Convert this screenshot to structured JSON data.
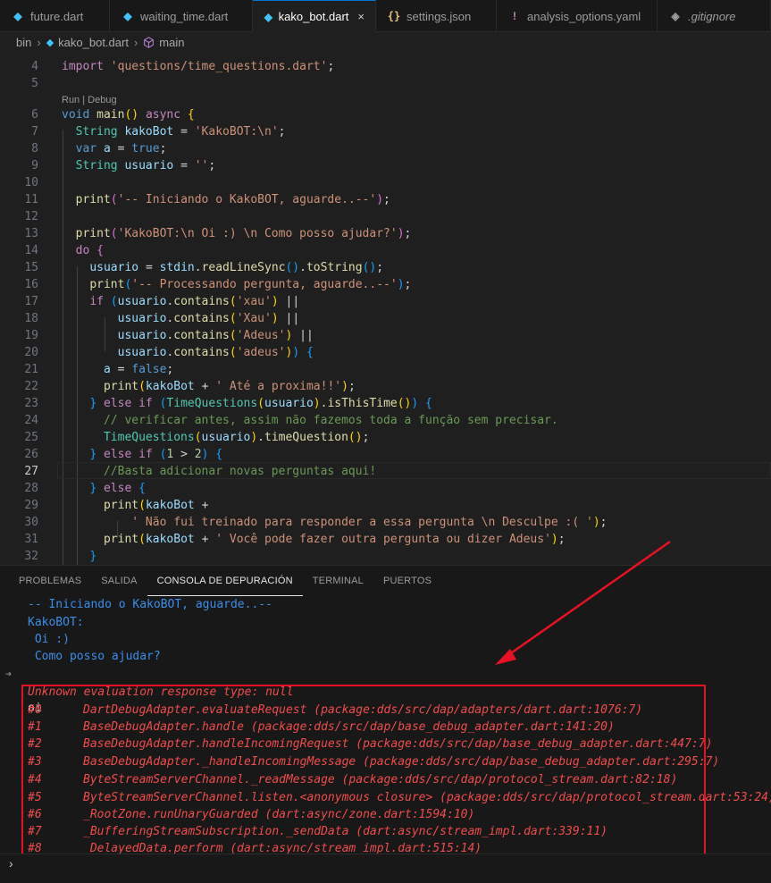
{
  "tabs": [
    {
      "label": "future.dart",
      "icon": "dart-icon",
      "active": false
    },
    {
      "label": "waiting_time.dart",
      "icon": "dart-icon",
      "active": false
    },
    {
      "label": "kako_bot.dart",
      "icon": "dart-icon",
      "active": true,
      "close": "×"
    },
    {
      "label": "settings.json",
      "icon": "json-braces-icon",
      "active": false
    },
    {
      "label": "analysis_options.yaml",
      "icon": "exclamation-icon",
      "active": false
    },
    {
      "label": ".gitignore",
      "icon": "git-icon",
      "active": false
    }
  ],
  "breadcrumb": {
    "folder": "bin",
    "file": "kako_bot.dart",
    "symbol": "main",
    "sep": "›"
  },
  "editor": {
    "codelens": "Run | Debug",
    "line_numbers": [
      "4",
      "5",
      "6",
      "7",
      "8",
      "9",
      "10",
      "11",
      "12",
      "13",
      "14",
      "15",
      "16",
      "17",
      "18",
      "19",
      "20",
      "21",
      "22",
      "23",
      "24",
      "25",
      "26",
      "27",
      "28",
      "29",
      "30",
      "31",
      "32"
    ],
    "current_line": "27"
  },
  "panel": {
    "tabs": [
      "PROBLEMAS",
      "SALIDA",
      "CONSOLA DE DEPURACIÓN",
      "TERMINAL",
      "PUERTOS"
    ],
    "active_tab": "CONSOLA DE DEPURACIÓN",
    "output": [
      "-- Iniciando o KakoBOT, aguarde..--",
      "KakoBOT:",
      " Oi :)",
      " Como posso ajudar?"
    ],
    "user_input": "oi",
    "error_header": "Unknown evaluation response type: null",
    "stack": [
      {
        "n": "#0",
        "t": "DartDebugAdapter.evaluateRequest (package:dds/src/dap/adapters/dart.dart:1076:7)"
      },
      {
        "n": "#1",
        "t": "BaseDebugAdapter.handle (package:dds/src/dap/base_debug_adapter.dart:141:20)"
      },
      {
        "n": "#2",
        "t": "BaseDebugAdapter.handleIncomingRequest (package:dds/src/dap/base_debug_adapter.dart:447:7)"
      },
      {
        "n": "#3",
        "t": "BaseDebugAdapter._handleIncomingMessage (package:dds/src/dap/base_debug_adapter.dart:295:7)"
      },
      {
        "n": "#4",
        "t": "ByteStreamServerChannel._readMessage (package:dds/src/dap/protocol_stream.dart:82:18)"
      },
      {
        "n": "#5",
        "t": "ByteStreamServerChannel.listen.<anonymous closure> (package:dds/src/dap/protocol_stream.dart:53:24)"
      },
      {
        "n": "#6",
        "t": "_RootZone.runUnaryGuarded (dart:async/zone.dart:1594:10)"
      },
      {
        "n": "#7",
        "t": "_BufferingStreamSubscription._sendData (dart:async/stream_impl.dart:339:11)"
      },
      {
        "n": "#8",
        "t": " DelayedData.perform (dart:async/stream_impl.dart:515:14)"
      }
    ],
    "prompt": "›"
  },
  "colors": {
    "annotation": "#e81123",
    "accent": "#0078d4"
  }
}
